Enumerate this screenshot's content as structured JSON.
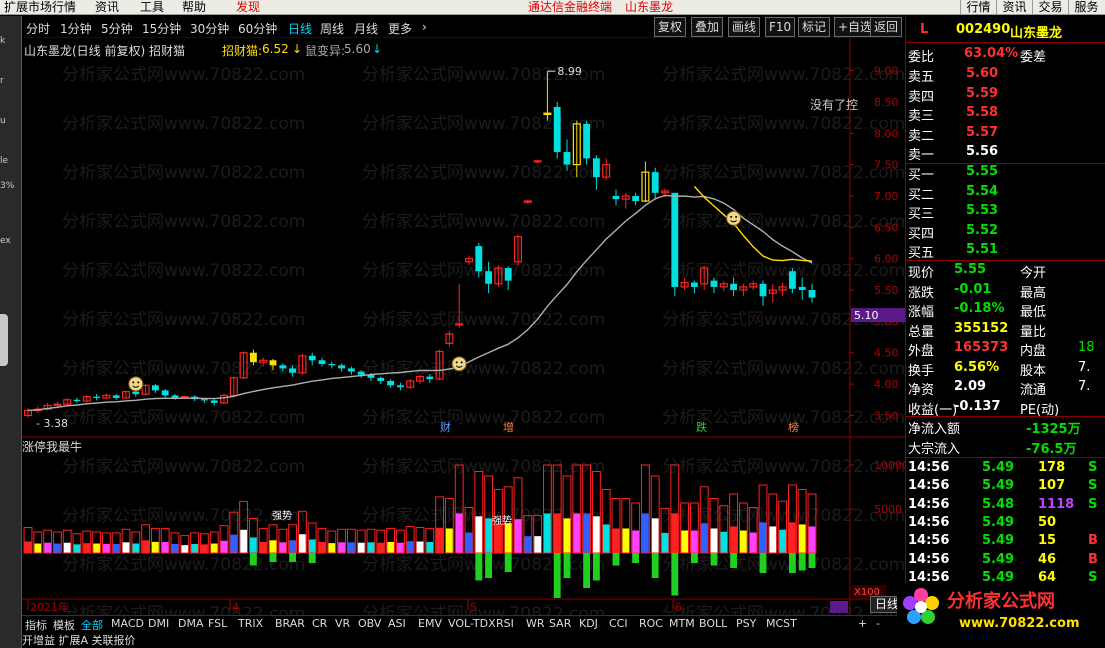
{
  "menubar": {
    "items": [
      "扩展市场行情",
      "资讯",
      "工具",
      "帮助"
    ],
    "active": "发现",
    "center": "通达信金融终端",
    "center_stock": "山东墨龙",
    "right": [
      "行情",
      "资讯",
      "交易",
      "服务"
    ]
  },
  "left_labels": [
    "k",
    "r",
    "u",
    "le",
    "3%",
    "ex"
  ],
  "periodbar": {
    "periods": [
      "分时",
      "1分钟",
      "5分钟",
      "15分钟",
      "30分钟",
      "60分钟",
      "日线",
      "周线",
      "月线",
      "更多"
    ],
    "active": "日线",
    "chevron": "›",
    "buttons": [
      "复权",
      "叠加",
      "画线",
      "F10",
      "标记",
      "+自选",
      "返回"
    ]
  },
  "info": {
    "title": "山东墨龙(日线 前复权) 招财猫",
    "ind1_name": "招财猫:",
    "ind1_val": "6.52",
    "ind2_name": "鼠变异:",
    "ind2_val": "5.60",
    "note": "没有了控"
  },
  "colors": {
    "up": "#ff2020",
    "down": "#00e0e0",
    "yellow": "#ffe000",
    "accent": "#00d8ff",
    "panel_border": "#8a0000",
    "price_tag": "#5a1a8a"
  },
  "chart_data": {
    "type": "candlestick",
    "title": "山东墨龙(日线 前复权)",
    "indicator": "招财猫",
    "ylim": [
      3.3,
      9.2
    ],
    "yticks": [
      "9.00",
      "8.50",
      "8.00",
      "7.50",
      "7.00",
      "6.50",
      "6.00",
      "5.50",
      "5.00",
      "4.50",
      "4.00",
      "3.50"
    ],
    "high_label": "8.99",
    "low_label": "3.38",
    "current_price_tag": "5.10",
    "x_labels": [
      "2021年",
      "4",
      "5",
      "6"
    ],
    "markers": [
      "财",
      "增",
      "跌",
      "榜"
    ],
    "candles": [
      [
        3.5,
        3.58,
        3.47,
        3.62
      ],
      [
        3.58,
        3.6,
        3.54,
        3.64
      ],
      [
        3.6,
        3.66,
        3.58,
        3.7
      ],
      [
        3.66,
        3.68,
        3.62,
        3.72
      ],
      [
        3.68,
        3.75,
        3.66,
        3.78
      ],
      [
        3.75,
        3.73,
        3.7,
        3.78
      ],
      [
        3.73,
        3.8,
        3.72,
        3.83
      ],
      [
        3.8,
        3.78,
        3.74,
        3.84
      ],
      [
        3.78,
        3.82,
        3.76,
        3.85
      ],
      [
        3.82,
        3.78,
        3.75,
        3.84
      ],
      [
        3.78,
        3.88,
        3.77,
        3.9
      ],
      [
        3.88,
        3.84,
        3.8,
        3.9
      ],
      [
        3.84,
        3.98,
        3.82,
        4.0
      ],
      [
        3.98,
        3.9,
        3.86,
        4.0
      ],
      [
        3.9,
        3.82,
        3.78,
        3.92
      ],
      [
        3.82,
        3.78,
        3.75,
        3.84
      ],
      [
        3.78,
        3.8,
        3.76,
        3.82
      ],
      [
        3.8,
        3.76,
        3.73,
        3.82
      ],
      [
        3.76,
        3.74,
        3.7,
        3.78
      ],
      [
        3.74,
        3.7,
        3.66,
        3.76
      ],
      [
        3.7,
        3.82,
        3.68,
        3.85
      ],
      [
        3.82,
        4.1,
        3.8,
        4.12
      ],
      [
        4.1,
        4.5,
        4.08,
        4.52
      ],
      [
        4.5,
        4.35,
        4.3,
        4.55
      ],
      [
        4.35,
        4.38,
        4.28,
        4.42
      ],
      [
        4.38,
        4.3,
        4.22,
        4.4
      ],
      [
        4.3,
        4.25,
        4.2,
        4.33
      ],
      [
        4.25,
        4.18,
        4.12,
        4.3
      ],
      [
        4.18,
        4.45,
        4.15,
        4.48
      ],
      [
        4.45,
        4.38,
        4.3,
        4.5
      ],
      [
        4.38,
        4.32,
        4.28,
        4.42
      ],
      [
        4.32,
        4.3,
        4.25,
        4.36
      ],
      [
        4.3,
        4.25,
        4.2,
        4.33
      ],
      [
        4.25,
        4.2,
        4.15,
        4.28
      ],
      [
        4.2,
        4.15,
        4.1,
        4.22
      ],
      [
        4.15,
        4.1,
        4.05,
        4.18
      ],
      [
        4.1,
        4.05,
        4.0,
        4.12
      ],
      [
        4.05,
        3.98,
        3.94,
        4.08
      ],
      [
        3.98,
        3.95,
        3.9,
        4.02
      ],
      [
        3.95,
        4.05,
        3.92,
        4.08
      ],
      [
        4.05,
        4.12,
        4.0,
        4.15
      ],
      [
        4.12,
        4.08,
        4.02,
        4.16
      ],
      [
        4.08,
        4.52,
        4.06,
        4.55
      ],
      [
        4.65,
        4.8,
        4.6,
        4.85
      ],
      [
        4.95,
        4.96,
        4.9,
        5.6
      ],
      [
        5.95,
        6.0,
        5.9,
        6.05
      ],
      [
        6.2,
        5.8,
        5.7,
        6.25
      ],
      [
        5.8,
        5.6,
        5.45,
        5.95
      ],
      [
        5.6,
        5.85,
        5.55,
        5.9
      ],
      [
        5.85,
        5.65,
        5.5,
        5.88
      ],
      [
        5.95,
        6.35,
        5.9,
        6.38
      ],
      [
        6.9,
        6.92,
        6.88,
        6.94
      ],
      [
        7.55,
        7.56,
        7.52,
        7.58
      ],
      [
        8.3,
        8.32,
        8.2,
        8.99
      ],
      [
        8.42,
        7.7,
        7.6,
        8.5
      ],
      [
        7.7,
        7.5,
        7.4,
        7.9
      ],
      [
        7.5,
        8.15,
        7.3,
        8.2
      ],
      [
        8.15,
        7.6,
        7.5,
        8.2
      ],
      [
        7.6,
        7.3,
        7.1,
        7.65
      ],
      [
        7.3,
        7.5,
        7.25,
        7.6
      ],
      [
        7.0,
        6.95,
        6.85,
        7.1
      ],
      [
        6.95,
        7.0,
        6.8,
        7.05
      ],
      [
        7.0,
        6.92,
        6.85,
        7.05
      ],
      [
        6.92,
        7.38,
        6.9,
        7.55
      ],
      [
        7.38,
        7.05,
        6.95,
        7.45
      ],
      [
        7.05,
        7.08,
        6.98,
        7.12
      ],
      [
        7.05,
        5.55,
        5.4,
        6.25
      ],
      [
        5.55,
        5.62,
        5.5,
        5.7
      ],
      [
        5.62,
        5.55,
        5.45,
        5.65
      ],
      [
        5.6,
        5.85,
        5.5,
        5.88
      ],
      [
        5.65,
        5.55,
        5.45,
        5.7
      ],
      [
        5.55,
        5.6,
        5.48,
        5.65
      ],
      [
        5.6,
        5.5,
        5.4,
        5.7
      ],
      [
        5.5,
        5.55,
        5.4,
        5.6
      ],
      [
        5.55,
        5.6,
        5.5,
        5.65
      ],
      [
        5.6,
        5.4,
        5.25,
        5.65
      ],
      [
        5.45,
        5.5,
        5.3,
        5.6
      ],
      [
        5.5,
        5.55,
        5.4,
        5.62
      ],
      [
        5.8,
        5.52,
        5.45,
        5.85
      ],
      [
        5.55,
        5.5,
        5.35,
        5.7
      ],
      [
        5.5,
        5.38,
        5.3,
        5.6
      ]
    ],
    "sub_title": "涨停我最牛",
    "sub_yticks": [
      "10000",
      "5000"
    ],
    "sub_extra": "X100",
    "sub_labels": [
      "强势",
      "强势",
      "增"
    ]
  },
  "rightpanel": {
    "code_prefix": "L",
    "code": "002490",
    "name": "山东墨龙",
    "weibi_label": "委比",
    "weibi": "63.04%",
    "weicha_label": "委差",
    "sells": [
      {
        "label": "卖五",
        "price": "5.60"
      },
      {
        "label": "卖四",
        "price": "5.59"
      },
      {
        "label": "卖三",
        "price": "5.58"
      },
      {
        "label": "卖二",
        "price": "5.57"
      },
      {
        "label": "卖一",
        "price": "5.56"
      }
    ],
    "buys": [
      {
        "label": "买一",
        "price": "5.55"
      },
      {
        "label": "买二",
        "price": "5.54"
      },
      {
        "label": "买三",
        "price": "5.53"
      },
      {
        "label": "买四",
        "price": "5.52"
      },
      {
        "label": "买五",
        "price": "5.51"
      }
    ],
    "stats": [
      {
        "k": "现价",
        "v": "5.55",
        "k2": "今开",
        "v2": ""
      },
      {
        "k": "涨跌",
        "v": "-0.01",
        "k2": "最高",
        "v2": ""
      },
      {
        "k": "涨幅",
        "v": "-0.18%",
        "k2": "最低",
        "v2": ""
      },
      {
        "k": "总量",
        "v": "355152",
        "k2": "量比",
        "v2": ""
      },
      {
        "k": "外盘",
        "v": "165373",
        "k2": "内盘",
        "v2": "18"
      },
      {
        "k": "换手",
        "v": "6.56%",
        "k2": "股本",
        "v2": "7."
      },
      {
        "k": "净资",
        "v": "2.09",
        "k2": "流通",
        "v2": "7."
      },
      {
        "k": "收益(一)",
        "v": "-0.137",
        "k2": "PE(动)",
        "v2": ""
      }
    ],
    "flow": [
      {
        "k": "净流入额",
        "v": "-1325万"
      },
      {
        "k": "大宗流入",
        "v": "-76.5万"
      }
    ],
    "ticks": [
      {
        "t": "14:56",
        "p": "5.49",
        "v": "178",
        "s": "S"
      },
      {
        "t": "14:56",
        "p": "5.49",
        "v": "107",
        "s": "S"
      },
      {
        "t": "14:56",
        "p": "5.48",
        "v": "1118",
        "s": "S"
      },
      {
        "t": "14:56",
        "p": "5.49",
        "v": "50",
        "s": ""
      },
      {
        "t": "14:56",
        "p": "5.49",
        "v": "15",
        "s": "B"
      },
      {
        "t": "14:56",
        "p": "5.49",
        "v": "46",
        "s": "B"
      },
      {
        "t": "14:56",
        "p": "5.49",
        "v": "64",
        "s": "S"
      }
    ],
    "bottom_tab": "日线"
  },
  "bottomtabs": [
    "指标",
    "模板",
    "全部",
    "MACD",
    "DMI",
    "DMA",
    "FSL",
    "TRIX",
    "BRAR",
    "CR",
    "VR",
    "OBV",
    "ASI",
    "EMV",
    "VOL-TDX",
    "RSI",
    "WR",
    "SAR",
    "KDJ",
    "CCI",
    "ROC",
    "MTM",
    "BOLL",
    "PSY",
    "MCST"
  ],
  "bottomtabs_active": "全部",
  "bottomtabs_ctrl": [
    "+",
    "-"
  ],
  "bottomtabs2": "开增益  扩展A  关联报价",
  "watermark": "分析家公式网www.70822.com",
  "logo": {
    "title": "分析家公式网",
    "url": "www.70822.com"
  }
}
